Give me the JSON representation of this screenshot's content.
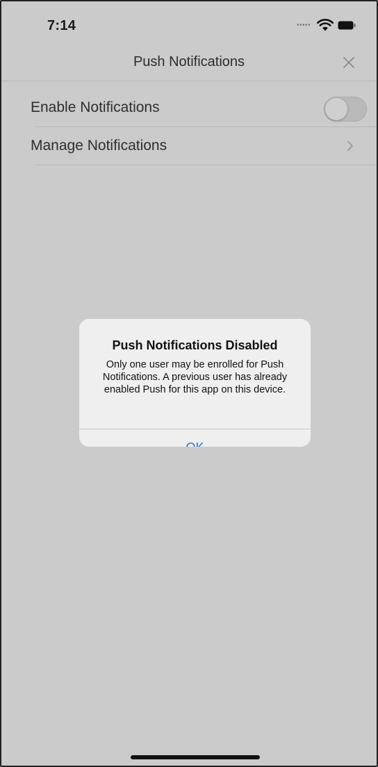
{
  "status_bar": {
    "time": "7:14",
    "signal_dots": "•••••",
    "icons": [
      "wifi-icon",
      "battery-icon"
    ]
  },
  "nav": {
    "title": "Push Notifications",
    "close_icon": "close-icon"
  },
  "list": {
    "items": [
      {
        "label": "Enable Notifications",
        "control": "toggle",
        "toggle_on": false
      },
      {
        "label": "Manage Notifications",
        "control": "chevron",
        "icon": "chevron-right-icon"
      }
    ]
  },
  "alert": {
    "title": "Push Notifications Disabled",
    "message": "Only one user may be enrolled for Push Notifications. A previous user has already enabled Push for this app on this device.",
    "ok_label": "OK"
  },
  "colors": {
    "background_dimmed": "#cbcbcb",
    "alert_background": "#efefef",
    "accent": "#1f73d4"
  }
}
